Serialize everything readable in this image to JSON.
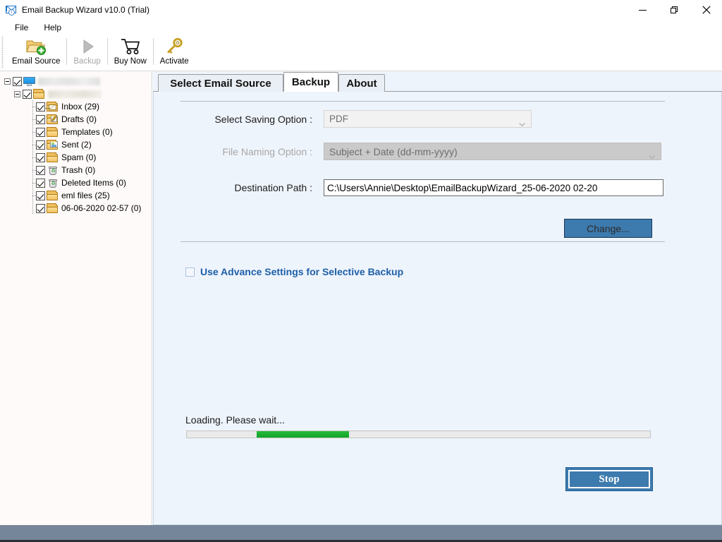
{
  "window": {
    "title": "Email Backup Wizard v10.0 (Trial)",
    "icon": "mail-app-icon",
    "controls": {
      "minimize": "minimize-button",
      "maximize": "maximize-button",
      "close": "close-button"
    }
  },
  "menubar": {
    "items": [
      {
        "label": "File"
      },
      {
        "label": "Help"
      }
    ]
  },
  "toolbar": {
    "buttons": [
      {
        "label": "Email Source",
        "icon": "folder-add-icon",
        "enabled": true
      },
      {
        "label": "Backup",
        "icon": "play-triangle-icon",
        "enabled": false
      },
      {
        "label": "Buy Now",
        "icon": "shopping-cart-icon",
        "enabled": true
      },
      {
        "label": "Activate",
        "icon": "key-icon",
        "enabled": true
      }
    ]
  },
  "sidebar": {
    "root": {
      "label": "",
      "redacted": true,
      "icon": "monitor-icon",
      "checked": true,
      "expanded": true
    },
    "account": {
      "label": "",
      "redacted": true,
      "icon": "folder-icon",
      "checked": true,
      "expanded": true
    },
    "folders": [
      {
        "label": "Inbox (29)",
        "icon": "folder-inbox-icon",
        "checked": true
      },
      {
        "label": "Drafts (0)",
        "icon": "folder-drafts-icon",
        "checked": true
      },
      {
        "label": "Templates (0)",
        "icon": "folder-icon",
        "checked": true
      },
      {
        "label": "Sent (2)",
        "icon": "folder-sent-icon",
        "checked": true
      },
      {
        "label": "Spam (0)",
        "icon": "folder-icon",
        "checked": true
      },
      {
        "label": "Trash (0)",
        "icon": "trash-icon",
        "checked": true
      },
      {
        "label": "Deleted Items (0)",
        "icon": "trash-icon",
        "checked": true
      },
      {
        "label": "eml files (25)",
        "icon": "folder-icon",
        "checked": true
      },
      {
        "label": "06-06-2020 02-57 (0)",
        "icon": "folder-icon",
        "checked": true
      }
    ]
  },
  "tabs": [
    {
      "label": "Select Email Source",
      "active": false
    },
    {
      "label": "Backup",
      "active": true
    },
    {
      "label": "About",
      "active": false
    }
  ],
  "backup_panel": {
    "saving_option": {
      "label": "Select Saving Option :",
      "value": "PDF",
      "enabled": false
    },
    "file_naming_option": {
      "label": "File Naming Option :",
      "value": "Subject + Date (dd-mm-yyyy)",
      "enabled": false
    },
    "destination_path": {
      "label": "Destination Path :",
      "value": "C:\\Users\\Annie\\Desktop\\EmailBackupWizard_25-06-2020 02-20"
    },
    "change_button": "Change...",
    "advance_settings": {
      "label": "Use Advance Settings for Selective Backup",
      "checked": false
    },
    "status_text": "Loading. Please wait...",
    "progress": {
      "style": "marquee",
      "fill_start_percent": 15,
      "fill_width_percent": 20,
      "color": "#1fae32"
    },
    "stop_button": "Stop"
  },
  "colors": {
    "accent_blue": "#3d7aad",
    "link_blue": "#1d5fa8",
    "panel_bg": "#eef4fc",
    "sidebar_bg": "#fdfaf9",
    "progress_green": "#1fae32",
    "taskbar": "#76869a"
  }
}
